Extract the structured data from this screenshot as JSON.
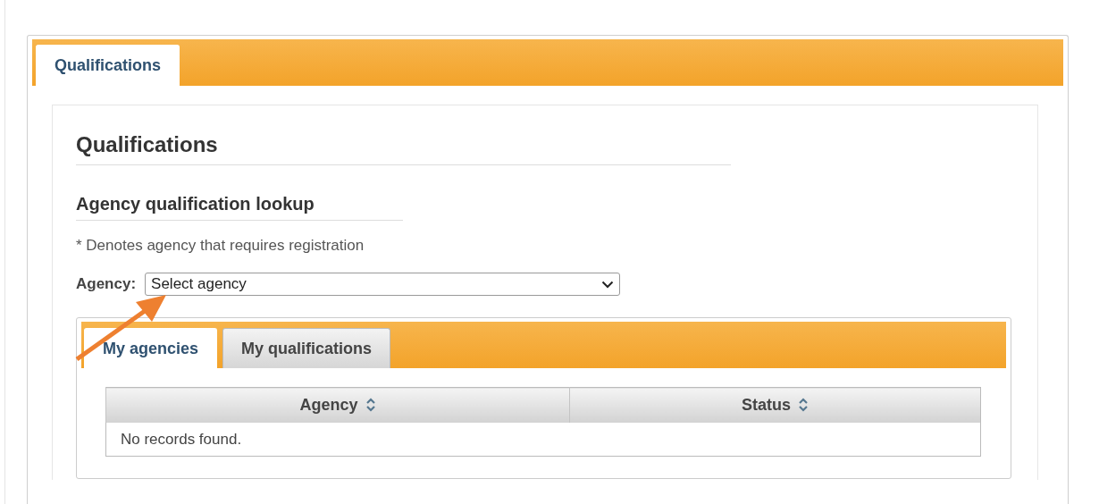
{
  "page_tabs": [
    {
      "label": "Qualifications",
      "selected": true
    }
  ],
  "title": "Qualifications",
  "section": {
    "title": "Agency qualification lookup",
    "note": "* Denotes agency that requires registration"
  },
  "agency_select": {
    "label": "Agency:",
    "value": "Select agency"
  },
  "tabs": [
    {
      "label": "My agencies",
      "selected": true
    },
    {
      "label": "My qualifications",
      "selected": false
    }
  ],
  "table": {
    "columns": [
      "Agency",
      "Status"
    ],
    "empty_message": "No records found."
  }
}
